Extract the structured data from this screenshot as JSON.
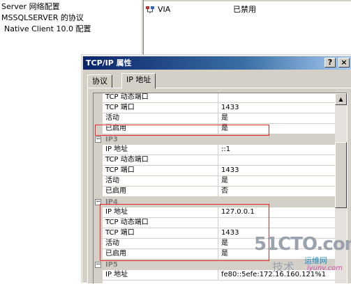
{
  "tree": {
    "items": [
      {
        "label": "Server 网络配置"
      },
      {
        "label": "MSSQLSERVER 的协议"
      },
      {
        "label": "Native Client 10.0 配置"
      }
    ]
  },
  "list": {
    "rows": [
      {
        "name": "VIA",
        "status": "已禁用"
      }
    ]
  },
  "dialog": {
    "title": "TCP/IP 属性",
    "help_label": "?",
    "close_label": "×",
    "tabs": [
      {
        "label": "协议"
      },
      {
        "label": "IP 地址"
      }
    ]
  },
  "grid": {
    "rows": [
      {
        "kind": "row",
        "name": "TCP 动态端口",
        "value": ""
      },
      {
        "kind": "row",
        "name": "TCP 端口",
        "value": "1433"
      },
      {
        "kind": "row",
        "name": "活动",
        "value": "是"
      },
      {
        "kind": "row",
        "name": "已启用",
        "value": "是"
      },
      {
        "kind": "cat",
        "name": "IP3"
      },
      {
        "kind": "row",
        "name": "IP 地址",
        "value": "::1"
      },
      {
        "kind": "row",
        "name": "TCP 动态端口",
        "value": ""
      },
      {
        "kind": "row",
        "name": "TCP 端口",
        "value": "1433"
      },
      {
        "kind": "row",
        "name": "活动",
        "value": "是"
      },
      {
        "kind": "row",
        "name": "已启用",
        "value": "否"
      },
      {
        "kind": "cat",
        "name": "IP4"
      },
      {
        "kind": "row",
        "name": "IP 地址",
        "value": "127.0.0.1"
      },
      {
        "kind": "row",
        "name": "TCP 动态端口",
        "value": ""
      },
      {
        "kind": "row",
        "name": "TCP 端口",
        "value": "1433"
      },
      {
        "kind": "row",
        "name": "活动",
        "value": "是"
      },
      {
        "kind": "row",
        "name": "已启用",
        "value": "是"
      },
      {
        "kind": "cat",
        "name": "IP5"
      },
      {
        "kind": "row",
        "name": "IP 地址",
        "value": "fe80::5efe:172.16.160.121%1"
      }
    ]
  },
  "watermark": {
    "main": "51CTO.com",
    "sub1": "技术",
    "sub2": "运维网",
    "sub3": "iyunv.com"
  },
  "colors": {
    "highlight_box": "#e8262a",
    "titlebar_start": "#0a246a",
    "dialog_face": "#d4d0c8"
  }
}
